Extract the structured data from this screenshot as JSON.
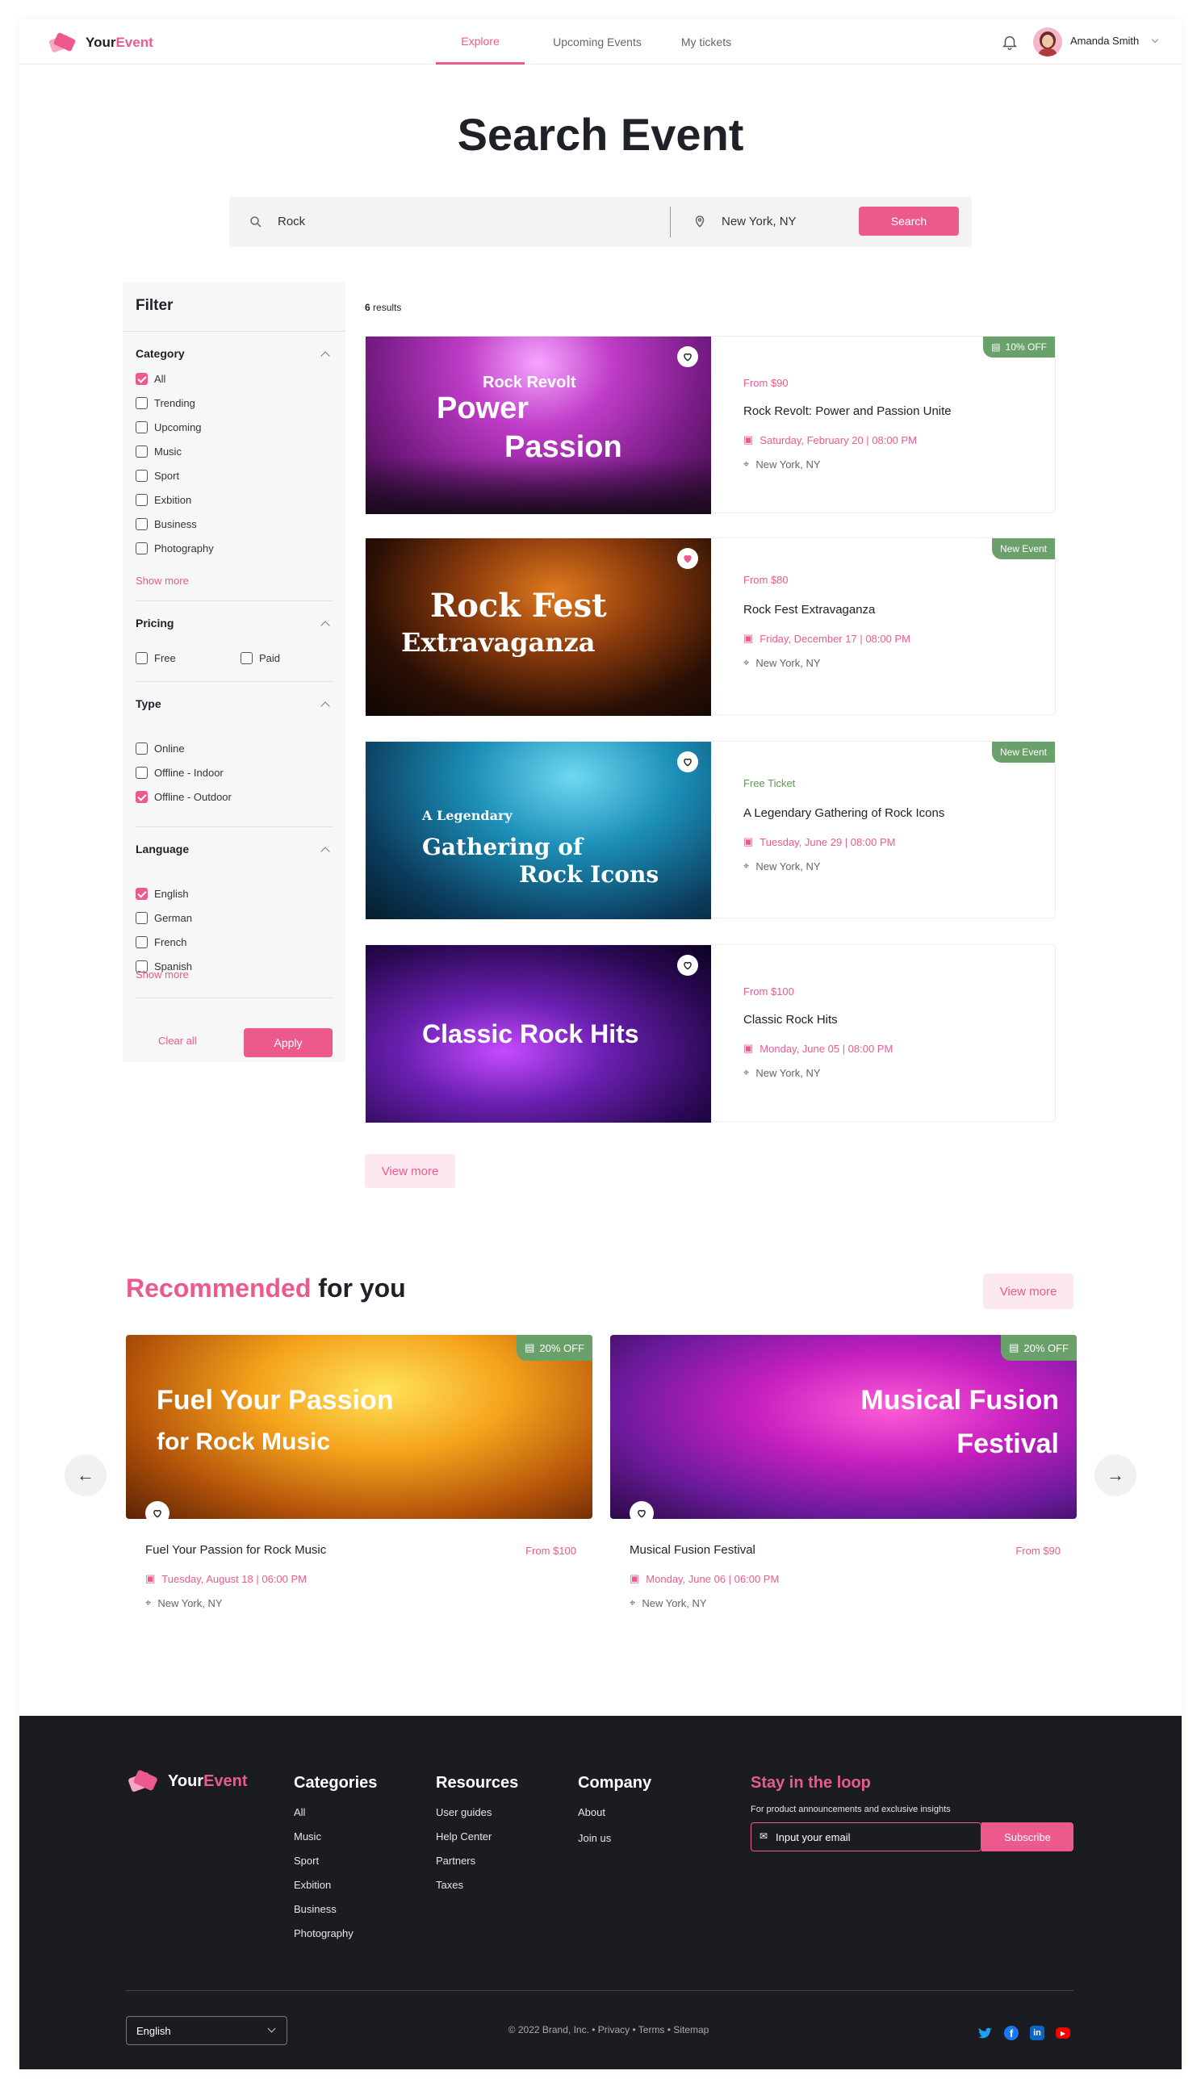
{
  "brand": {
    "part1": "Your",
    "part2": "Event"
  },
  "nav": {
    "items": [
      "Explore",
      "Upcoming Events",
      "My tickets"
    ],
    "active": "Explore"
  },
  "user": {
    "name": "Amanda Smith"
  },
  "page_title": "Search Event",
  "search": {
    "query": "Rock",
    "location": "New York, NY",
    "button": "Search"
  },
  "results": {
    "count": "6",
    "label": "results"
  },
  "filter": {
    "title": "Filter",
    "category": {
      "title": "Category",
      "items": [
        {
          "label": "All",
          "checked": true
        },
        {
          "label": "Trending",
          "checked": false
        },
        {
          "label": "Upcoming",
          "checked": false
        },
        {
          "label": "Music",
          "checked": false
        },
        {
          "label": "Sport",
          "checked": false
        },
        {
          "label": "Exbition",
          "checked": false
        },
        {
          "label": "Business",
          "checked": false
        },
        {
          "label": "Photography",
          "checked": false
        }
      ],
      "show_more": "Show more"
    },
    "pricing": {
      "title": "Pricing",
      "items": [
        {
          "label": "Free",
          "checked": false
        },
        {
          "label": "Paid",
          "checked": false
        }
      ]
    },
    "type": {
      "title": "Type",
      "items": [
        {
          "label": "Online",
          "checked": false
        },
        {
          "label": "Offline - Indoor",
          "checked": false
        },
        {
          "label": "Offline - Outdoor",
          "checked": true
        }
      ]
    },
    "language": {
      "title": "Language",
      "items": [
        {
          "label": "English",
          "checked": true
        },
        {
          "label": "German",
          "checked": false
        },
        {
          "label": "French",
          "checked": false
        },
        {
          "label": "Spanish",
          "checked": false
        }
      ],
      "show_more": "Show more"
    },
    "clear": "Clear all",
    "apply": "Apply"
  },
  "events": [
    {
      "price": "From $90",
      "price_color": "#ec5a8d",
      "name": "Rock Revolt: Power and Passion Unite",
      "date": "Saturday, February 20 | 08:00 PM",
      "location": "New York, NY",
      "tag": "10% OFF",
      "liked": false,
      "img_lines": [
        "Rock Revolt",
        "Power",
        "Passion"
      ]
    },
    {
      "price": "From $80",
      "price_color": "#ec5a8d",
      "name": "Rock Fest Extravaganza",
      "date": "Friday, December 17 | 08:00 PM",
      "location": "New York, NY",
      "tag": "New Event",
      "liked": true,
      "img_lines": [
        "Rock Fest",
        "Extravaganza"
      ]
    },
    {
      "price": "Free Ticket",
      "price_color": "#5d9a4f",
      "name": "A Legendary Gathering of Rock Icons",
      "date": "Tuesday, June 29 | 08:00 PM",
      "location": "New York, NY",
      "tag": "New Event",
      "liked": false,
      "img_lines": [
        "A Legendary",
        "Gathering of",
        "Rock Icons"
      ]
    },
    {
      "price": "From $100",
      "price_color": "#ec5a8d",
      "name": "Classic Rock Hits",
      "date": "Monday, June 05 | 08:00 PM",
      "location": "New York, NY",
      "tag": "",
      "liked": false,
      "img_lines": [
        "Classic Rock Hits"
      ]
    }
  ],
  "view_more": "View more",
  "recommended": {
    "title_pink": "Recommended",
    "title_rest": "for you",
    "view_more": "View more",
    "items": [
      {
        "name": "Fuel Your Passion for Rock Music",
        "price": "From $100",
        "date": "Tuesday, August 18 | 06:00 PM",
        "location": "New York, NY",
        "tag": "20% OFF",
        "img_lines": [
          "Fuel Your Passion",
          "for Rock Music"
        ]
      },
      {
        "name": "Musical Fusion Festival",
        "price": "From $90",
        "date": "Monday, June 06 | 06:00 PM",
        "location": "New York, NY",
        "tag": "20% OFF",
        "img_lines": [
          "Musical Fusion",
          "Festival"
        ]
      }
    ]
  },
  "footer": {
    "categories": {
      "title": "Categories",
      "items": [
        "All",
        "Music",
        "Sport",
        "Exbition",
        "Business",
        "Photography"
      ]
    },
    "resources": {
      "title": "Resources",
      "items": [
        "User guides",
        "Help Center",
        "Partners",
        "Taxes"
      ]
    },
    "company": {
      "title": "Company",
      "items": [
        "About",
        "Join us"
      ]
    },
    "newsletter": {
      "title": "Stay in the loop",
      "subtitle": "For product announcements and exclusive insights",
      "placeholder": "Input your email",
      "button": "Subscribe"
    },
    "language": "English",
    "copyright": "© 2022 Brand, Inc.  • Privacy  • Terms  • Sitemap",
    "social": [
      "twitter-icon",
      "facebook-icon",
      "linkedin-icon",
      "youtube-icon"
    ]
  }
}
